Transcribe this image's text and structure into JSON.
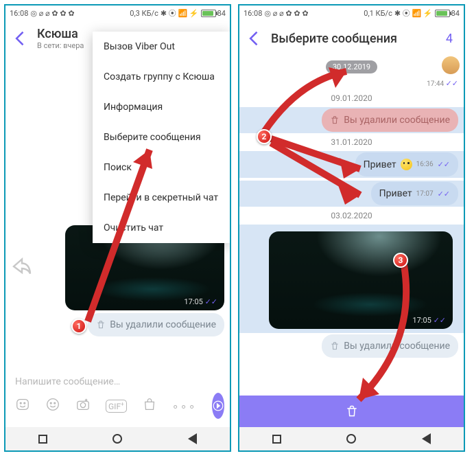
{
  "status": {
    "time": "16:08",
    "kbps": "0,3 КБ/с",
    "kbps2": "0,1 КБ/с",
    "batt": "84"
  },
  "left": {
    "contact": "Ксюша",
    "presence": "В сети: вчера",
    "menu": {
      "call": "Вызов Viber Out",
      "group": "Создать группу с Ксюша",
      "info": "Информация",
      "select": "Выберите сообщения",
      "search": "Поиск",
      "secret": "Перейти в секретный чат",
      "clear": "Очистить чат"
    },
    "img_time": "17:05",
    "deleted": "Вы удалили сообщение",
    "compose": "Напишите сообщение…"
  },
  "right": {
    "title": "Выберите сообщения",
    "count": "4",
    "d1": "30.12.2019",
    "t1": "17:44",
    "d2": "09.01.2020",
    "deleted": "Вы удалили сообщение",
    "d3": "31.01.2020",
    "msg1": "Привет",
    "mt1": "16:36",
    "msg2": "Привет",
    "mt2": "17:07",
    "d4": "03.02.2020",
    "img_time": "17:05"
  },
  "markers": {
    "m1": "1",
    "m2": "2",
    "m3": "3"
  }
}
